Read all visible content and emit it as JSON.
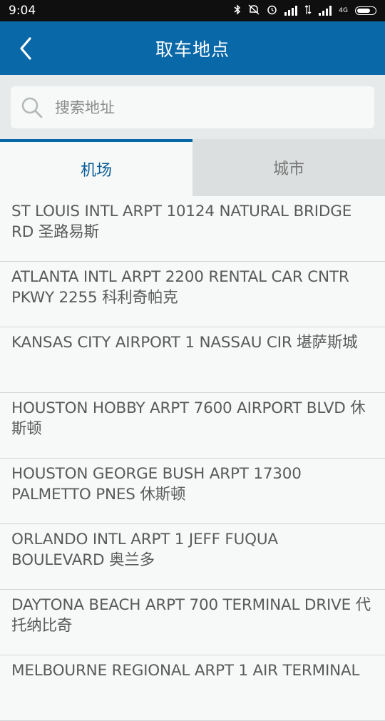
{
  "status_bar": {
    "time": "9:04",
    "network": "4G"
  },
  "header": {
    "title": "取车地点"
  },
  "search": {
    "placeholder": "搜索地址"
  },
  "tabs": [
    {
      "label": "机场",
      "active": true
    },
    {
      "label": "城市",
      "active": false
    }
  ],
  "locations": [
    "ST LOUIS INTL ARPT 10124 NATURAL BRIDGE RD 圣路易斯",
    "ATLANTA INTL ARPT 2200 RENTAL CAR CNTR PKWY 2255 科利奇帕克",
    "KANSAS CITY AIRPORT 1 NASSAU CIR 堪萨斯城",
    "HOUSTON HOBBY ARPT 7600 AIRPORT BLVD 休斯顿",
    "HOUSTON GEORGE BUSH ARPT 17300 PALMETTO PNES 休斯顿",
    "ORLANDO INTL ARPT 1 JEFF FUQUA BOULEVARD 奥兰多",
    "DAYTONA BEACH ARPT 700 TERMINAL DRIVE 代托纳比奇",
    "MELBOURNE REGIONAL ARPT 1 AIR TERMINAL"
  ],
  "colors": {
    "accent": "#0968a8",
    "active_tab_text": "#0b5c95"
  }
}
